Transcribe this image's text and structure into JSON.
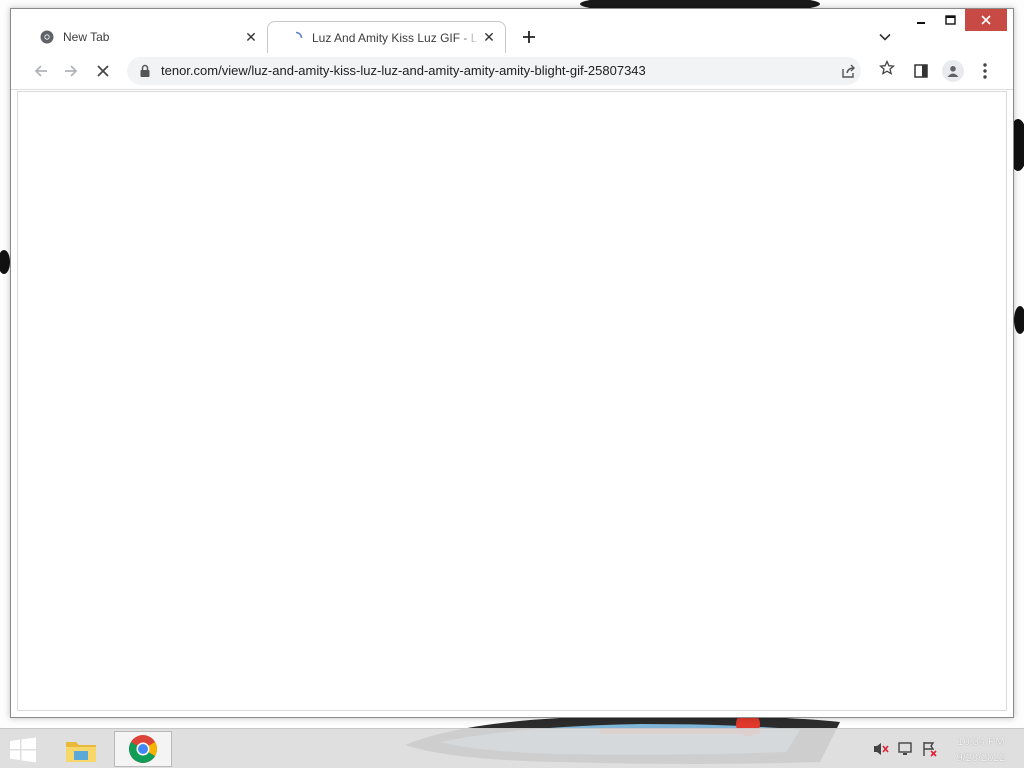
{
  "browser": {
    "tabs": [
      {
        "title": "New Tab",
        "active": false
      },
      {
        "title": "Luz And Amity Kiss Luz GIF - Luz",
        "active": true,
        "loading": true
      }
    ],
    "new_tab_icon": "plus-icon",
    "tab_search_icon": "chevron-down-icon",
    "window_controls": [
      "minimize-icon",
      "maximize-icon",
      "close-icon"
    ],
    "toolbar": {
      "back_icon": "arrow-left-icon",
      "forward_icon": "arrow-right-icon",
      "stop_icon": "stop-loading-icon",
      "url": "tenor.com/view/luz-and-amity-kiss-luz-luz-and-amity-amity-amity-blight-gif-25807343",
      "icons": [
        "lock-icon",
        "share-icon",
        "star-icon",
        "side-panel-icon",
        "profile-icon",
        "more-menu-icon"
      ]
    },
    "content": {
      "state": "blank"
    }
  },
  "taskbar": {
    "items": [
      "windows-start-icon",
      "file-explorer-icon",
      "chrome-icon"
    ],
    "tray": [
      "volume-muted-icon",
      "network-icon",
      "action-center-icon"
    ],
    "time": "10:34 PM",
    "date": "9/28/2022"
  },
  "colors": {
    "close_button": "#c74a45",
    "omnibox_bg": "#f1f3f4",
    "taskbar_bg": "#dcdcdc"
  }
}
